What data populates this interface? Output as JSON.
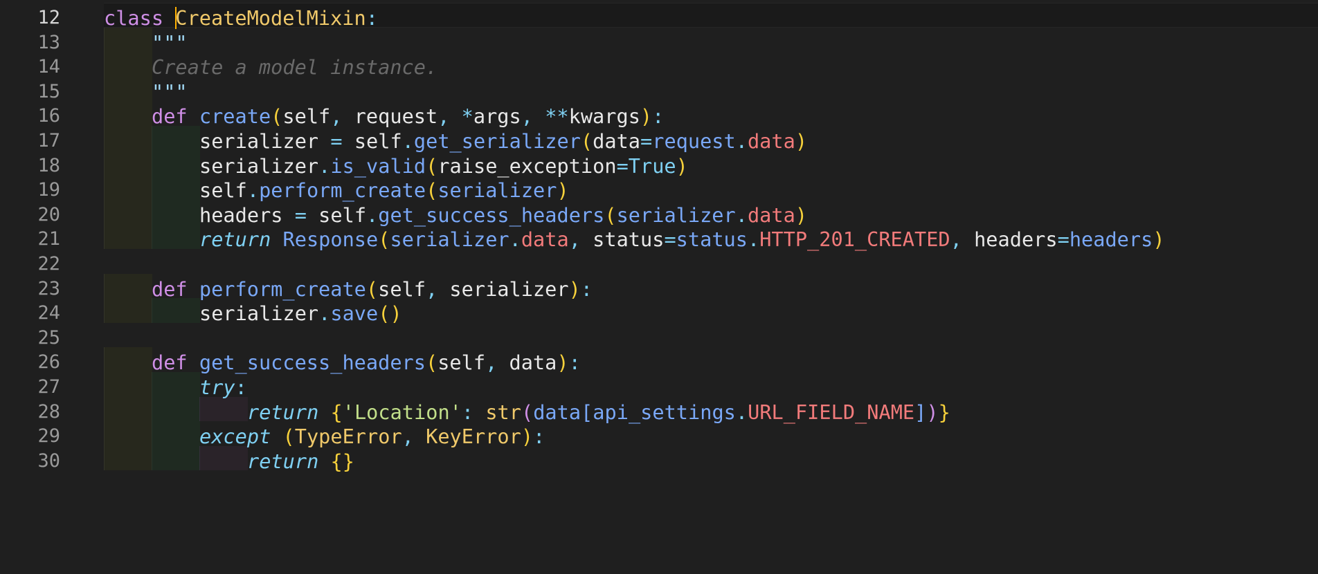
{
  "editor": {
    "language": "python",
    "current_line": "12",
    "cursor": {
      "line": "12",
      "after_token": 1
    },
    "colors": {
      "background": "#1f1f1f",
      "line_number": "#9a9a9a",
      "keyword": "#cf8fe6",
      "function": "#7aa8f7",
      "class_name": "#f0c96a",
      "plain": "#e8e8e8",
      "punctuation": "#7fd0f2",
      "bracket": "#f7d13b",
      "attribute": "#f27b7b",
      "string": "#c2df8a",
      "comment": "#6a6a6a",
      "cursor": "#ffb000"
    },
    "lines": [
      {
        "number": "12",
        "indent": 0,
        "tokens": [
          {
            "t": "class ",
            "c": "#cf8fe6"
          },
          {
            "t": "CreateModelMixin",
            "c": "#f0c96a"
          },
          {
            "t": ":",
            "c": "#7fd0f2"
          }
        ]
      },
      {
        "number": "13",
        "indent": 1,
        "tokens": [
          {
            "t": "\"\"\"",
            "c": "#9fd6f2"
          }
        ]
      },
      {
        "number": "14",
        "indent": 1,
        "tokens": [
          {
            "t": "Create a model instance.",
            "c": "#6a6a6a",
            "i": true
          }
        ]
      },
      {
        "number": "15",
        "indent": 1,
        "tokens": [
          {
            "t": "\"\"\"",
            "c": "#9fd6f2"
          }
        ]
      },
      {
        "number": "16",
        "indent": 1,
        "tokens": [
          {
            "t": "def ",
            "c": "#cf8fe6"
          },
          {
            "t": "create",
            "c": "#7aa8f7"
          },
          {
            "t": "(",
            "c": "#f7d13b"
          },
          {
            "t": "self",
            "c": "#e8e8e8"
          },
          {
            "t": ", ",
            "c": "#7fd0f2"
          },
          {
            "t": "request",
            "c": "#e8e8e8"
          },
          {
            "t": ", ",
            "c": "#7fd0f2"
          },
          {
            "t": "*",
            "c": "#7fd0f2"
          },
          {
            "t": "args",
            "c": "#e8e8e8"
          },
          {
            "t": ", ",
            "c": "#7fd0f2"
          },
          {
            "t": "**",
            "c": "#7fd0f2"
          },
          {
            "t": "kwargs",
            "c": "#e8e8e8"
          },
          {
            "t": ")",
            "c": "#f7d13b"
          },
          {
            "t": ":",
            "c": "#7fd0f2"
          }
        ]
      },
      {
        "number": "17",
        "indent": 2,
        "tokens": [
          {
            "t": "serializer ",
            "c": "#e8e8e8"
          },
          {
            "t": "= ",
            "c": "#7fd0f2"
          },
          {
            "t": "self",
            "c": "#e8e8e8"
          },
          {
            "t": ".",
            "c": "#7fd0f2"
          },
          {
            "t": "get_serializer",
            "c": "#7aa8f7"
          },
          {
            "t": "(",
            "c": "#f7d13b"
          },
          {
            "t": "data",
            "c": "#e8e8e8"
          },
          {
            "t": "=",
            "c": "#7fd0f2"
          },
          {
            "t": "request",
            "c": "#7aa8f7"
          },
          {
            "t": ".",
            "c": "#7fd0f2"
          },
          {
            "t": "data",
            "c": "#f27b7b"
          },
          {
            "t": ")",
            "c": "#f7d13b"
          }
        ]
      },
      {
        "number": "18",
        "indent": 2,
        "tokens": [
          {
            "t": "serializer",
            "c": "#e8e8e8"
          },
          {
            "t": ".",
            "c": "#7fd0f2"
          },
          {
            "t": "is_valid",
            "c": "#7aa8f7"
          },
          {
            "t": "(",
            "c": "#f7d13b"
          },
          {
            "t": "raise_exception",
            "c": "#e8e8e8"
          },
          {
            "t": "=",
            "c": "#7fd0f2"
          },
          {
            "t": "True",
            "c": "#7fd0f2"
          },
          {
            "t": ")",
            "c": "#f7d13b"
          }
        ]
      },
      {
        "number": "19",
        "indent": 2,
        "tokens": [
          {
            "t": "self",
            "c": "#e8e8e8"
          },
          {
            "t": ".",
            "c": "#7fd0f2"
          },
          {
            "t": "perform_create",
            "c": "#7aa8f7"
          },
          {
            "t": "(",
            "c": "#f7d13b"
          },
          {
            "t": "serializer",
            "c": "#7aa8f7"
          },
          {
            "t": ")",
            "c": "#f7d13b"
          }
        ]
      },
      {
        "number": "20",
        "indent": 2,
        "tokens": [
          {
            "t": "headers ",
            "c": "#e8e8e8"
          },
          {
            "t": "= ",
            "c": "#7fd0f2"
          },
          {
            "t": "self",
            "c": "#e8e8e8"
          },
          {
            "t": ".",
            "c": "#7fd0f2"
          },
          {
            "t": "get_success_headers",
            "c": "#7aa8f7"
          },
          {
            "t": "(",
            "c": "#f7d13b"
          },
          {
            "t": "serializer",
            "c": "#7aa8f7"
          },
          {
            "t": ".",
            "c": "#7fd0f2"
          },
          {
            "t": "data",
            "c": "#f27b7b"
          },
          {
            "t": ")",
            "c": "#f7d13b"
          }
        ]
      },
      {
        "number": "21",
        "indent": 2,
        "tokens": [
          {
            "t": "return ",
            "c": "#7fd0f2",
            "i": true
          },
          {
            "t": "Response",
            "c": "#7aa8f7"
          },
          {
            "t": "(",
            "c": "#f7d13b"
          },
          {
            "t": "serializer",
            "c": "#7aa8f7"
          },
          {
            "t": ".",
            "c": "#7fd0f2"
          },
          {
            "t": "data",
            "c": "#f27b7b"
          },
          {
            "t": ", ",
            "c": "#7fd0f2"
          },
          {
            "t": "status",
            "c": "#e8e8e8"
          },
          {
            "t": "=",
            "c": "#7fd0f2"
          },
          {
            "t": "status",
            "c": "#7aa8f7"
          },
          {
            "t": ".",
            "c": "#7fd0f2"
          },
          {
            "t": "HTTP_201_CREATED",
            "c": "#f27b7b"
          },
          {
            "t": ", ",
            "c": "#7fd0f2"
          },
          {
            "t": "headers",
            "c": "#e8e8e8"
          },
          {
            "t": "=",
            "c": "#7fd0f2"
          },
          {
            "t": "headers",
            "c": "#7aa8f7"
          },
          {
            "t": ")",
            "c": "#f7d13b"
          }
        ]
      },
      {
        "number": "22",
        "indent": 0,
        "tokens": []
      },
      {
        "number": "23",
        "indent": 1,
        "tokens": [
          {
            "t": "def ",
            "c": "#cf8fe6"
          },
          {
            "t": "perform_create",
            "c": "#7aa8f7"
          },
          {
            "t": "(",
            "c": "#f7d13b"
          },
          {
            "t": "self",
            "c": "#e8e8e8"
          },
          {
            "t": ", ",
            "c": "#7fd0f2"
          },
          {
            "t": "serializer",
            "c": "#e8e8e8"
          },
          {
            "t": ")",
            "c": "#f7d13b"
          },
          {
            "t": ":",
            "c": "#7fd0f2"
          }
        ]
      },
      {
        "number": "24",
        "indent": 2,
        "tokens": [
          {
            "t": "serializer",
            "c": "#e8e8e8"
          },
          {
            "t": ".",
            "c": "#7fd0f2"
          },
          {
            "t": "save",
            "c": "#7aa8f7"
          },
          {
            "t": "()",
            "c": "#f7d13b"
          }
        ]
      },
      {
        "number": "25",
        "indent": 0,
        "tokens": []
      },
      {
        "number": "26",
        "indent": 1,
        "tokens": [
          {
            "t": "def ",
            "c": "#cf8fe6"
          },
          {
            "t": "get_success_headers",
            "c": "#7aa8f7"
          },
          {
            "t": "(",
            "c": "#f7d13b"
          },
          {
            "t": "self",
            "c": "#e8e8e8"
          },
          {
            "t": ", ",
            "c": "#7fd0f2"
          },
          {
            "t": "data",
            "c": "#e8e8e8"
          },
          {
            "t": ")",
            "c": "#f7d13b"
          },
          {
            "t": ":",
            "c": "#7fd0f2"
          }
        ]
      },
      {
        "number": "27",
        "indent": 2,
        "tokens": [
          {
            "t": "try",
            "c": "#7fd0f2",
            "i": true
          },
          {
            "t": ":",
            "c": "#7fd0f2"
          }
        ]
      },
      {
        "number": "28",
        "indent": 3,
        "tokens": [
          {
            "t": "return ",
            "c": "#7fd0f2",
            "i": true
          },
          {
            "t": "{",
            "c": "#f7d13b"
          },
          {
            "t": "'Location'",
            "c": "#c2df8a"
          },
          {
            "t": ": ",
            "c": "#7fd0f2"
          },
          {
            "t": "str",
            "c": "#f0c96a"
          },
          {
            "t": "(",
            "c": "#cf8fe6"
          },
          {
            "t": "data",
            "c": "#7aa8f7"
          },
          {
            "t": "[",
            "c": "#7aa8f7"
          },
          {
            "t": "api_settings",
            "c": "#7aa8f7"
          },
          {
            "t": ".",
            "c": "#7fd0f2"
          },
          {
            "t": "URL_FIELD_NAME",
            "c": "#f27b7b"
          },
          {
            "t": "]",
            "c": "#7aa8f7"
          },
          {
            "t": ")",
            "c": "#cf8fe6"
          },
          {
            "t": "}",
            "c": "#f7d13b"
          }
        ]
      },
      {
        "number": "29",
        "indent": 2,
        "tokens": [
          {
            "t": "except ",
            "c": "#7fd0f2",
            "i": true
          },
          {
            "t": "(",
            "c": "#f7d13b"
          },
          {
            "t": "TypeError",
            "c": "#f0c96a"
          },
          {
            "t": ", ",
            "c": "#7fd0f2"
          },
          {
            "t": "KeyError",
            "c": "#f0c96a"
          },
          {
            "t": ")",
            "c": "#f7d13b"
          },
          {
            "t": ":",
            "c": "#7fd0f2"
          }
        ]
      },
      {
        "number": "30",
        "indent": 3,
        "tokens": [
          {
            "t": "return ",
            "c": "#7fd0f2",
            "i": true
          },
          {
            "t": "{}",
            "c": "#f7d13b"
          }
        ]
      }
    ]
  }
}
